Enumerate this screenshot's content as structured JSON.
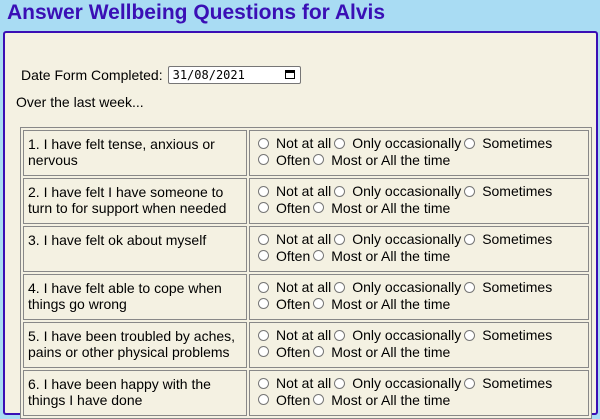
{
  "page": {
    "title": "Answer Wellbeing Questions for Alvis",
    "date_label": "Date Form Completed:",
    "date_value": "31/08/2021",
    "intro": "Over the last week..."
  },
  "options": [
    "Not at all",
    "Only occasionally",
    "Sometimes",
    "Often",
    "Most or All the time"
  ],
  "questions": [
    {
      "text": "1. I have felt tense, anxious or nervous"
    },
    {
      "text": "2. I have felt I have someone to turn to for support when needed"
    },
    {
      "text": "3. I have felt ok about myself"
    },
    {
      "text": "4. I have felt able to cope when things go wrong"
    },
    {
      "text": "5. I have been troubled by aches, pains or other physical problems"
    },
    {
      "text": "6. I have been happy with the things I have done"
    }
  ]
}
